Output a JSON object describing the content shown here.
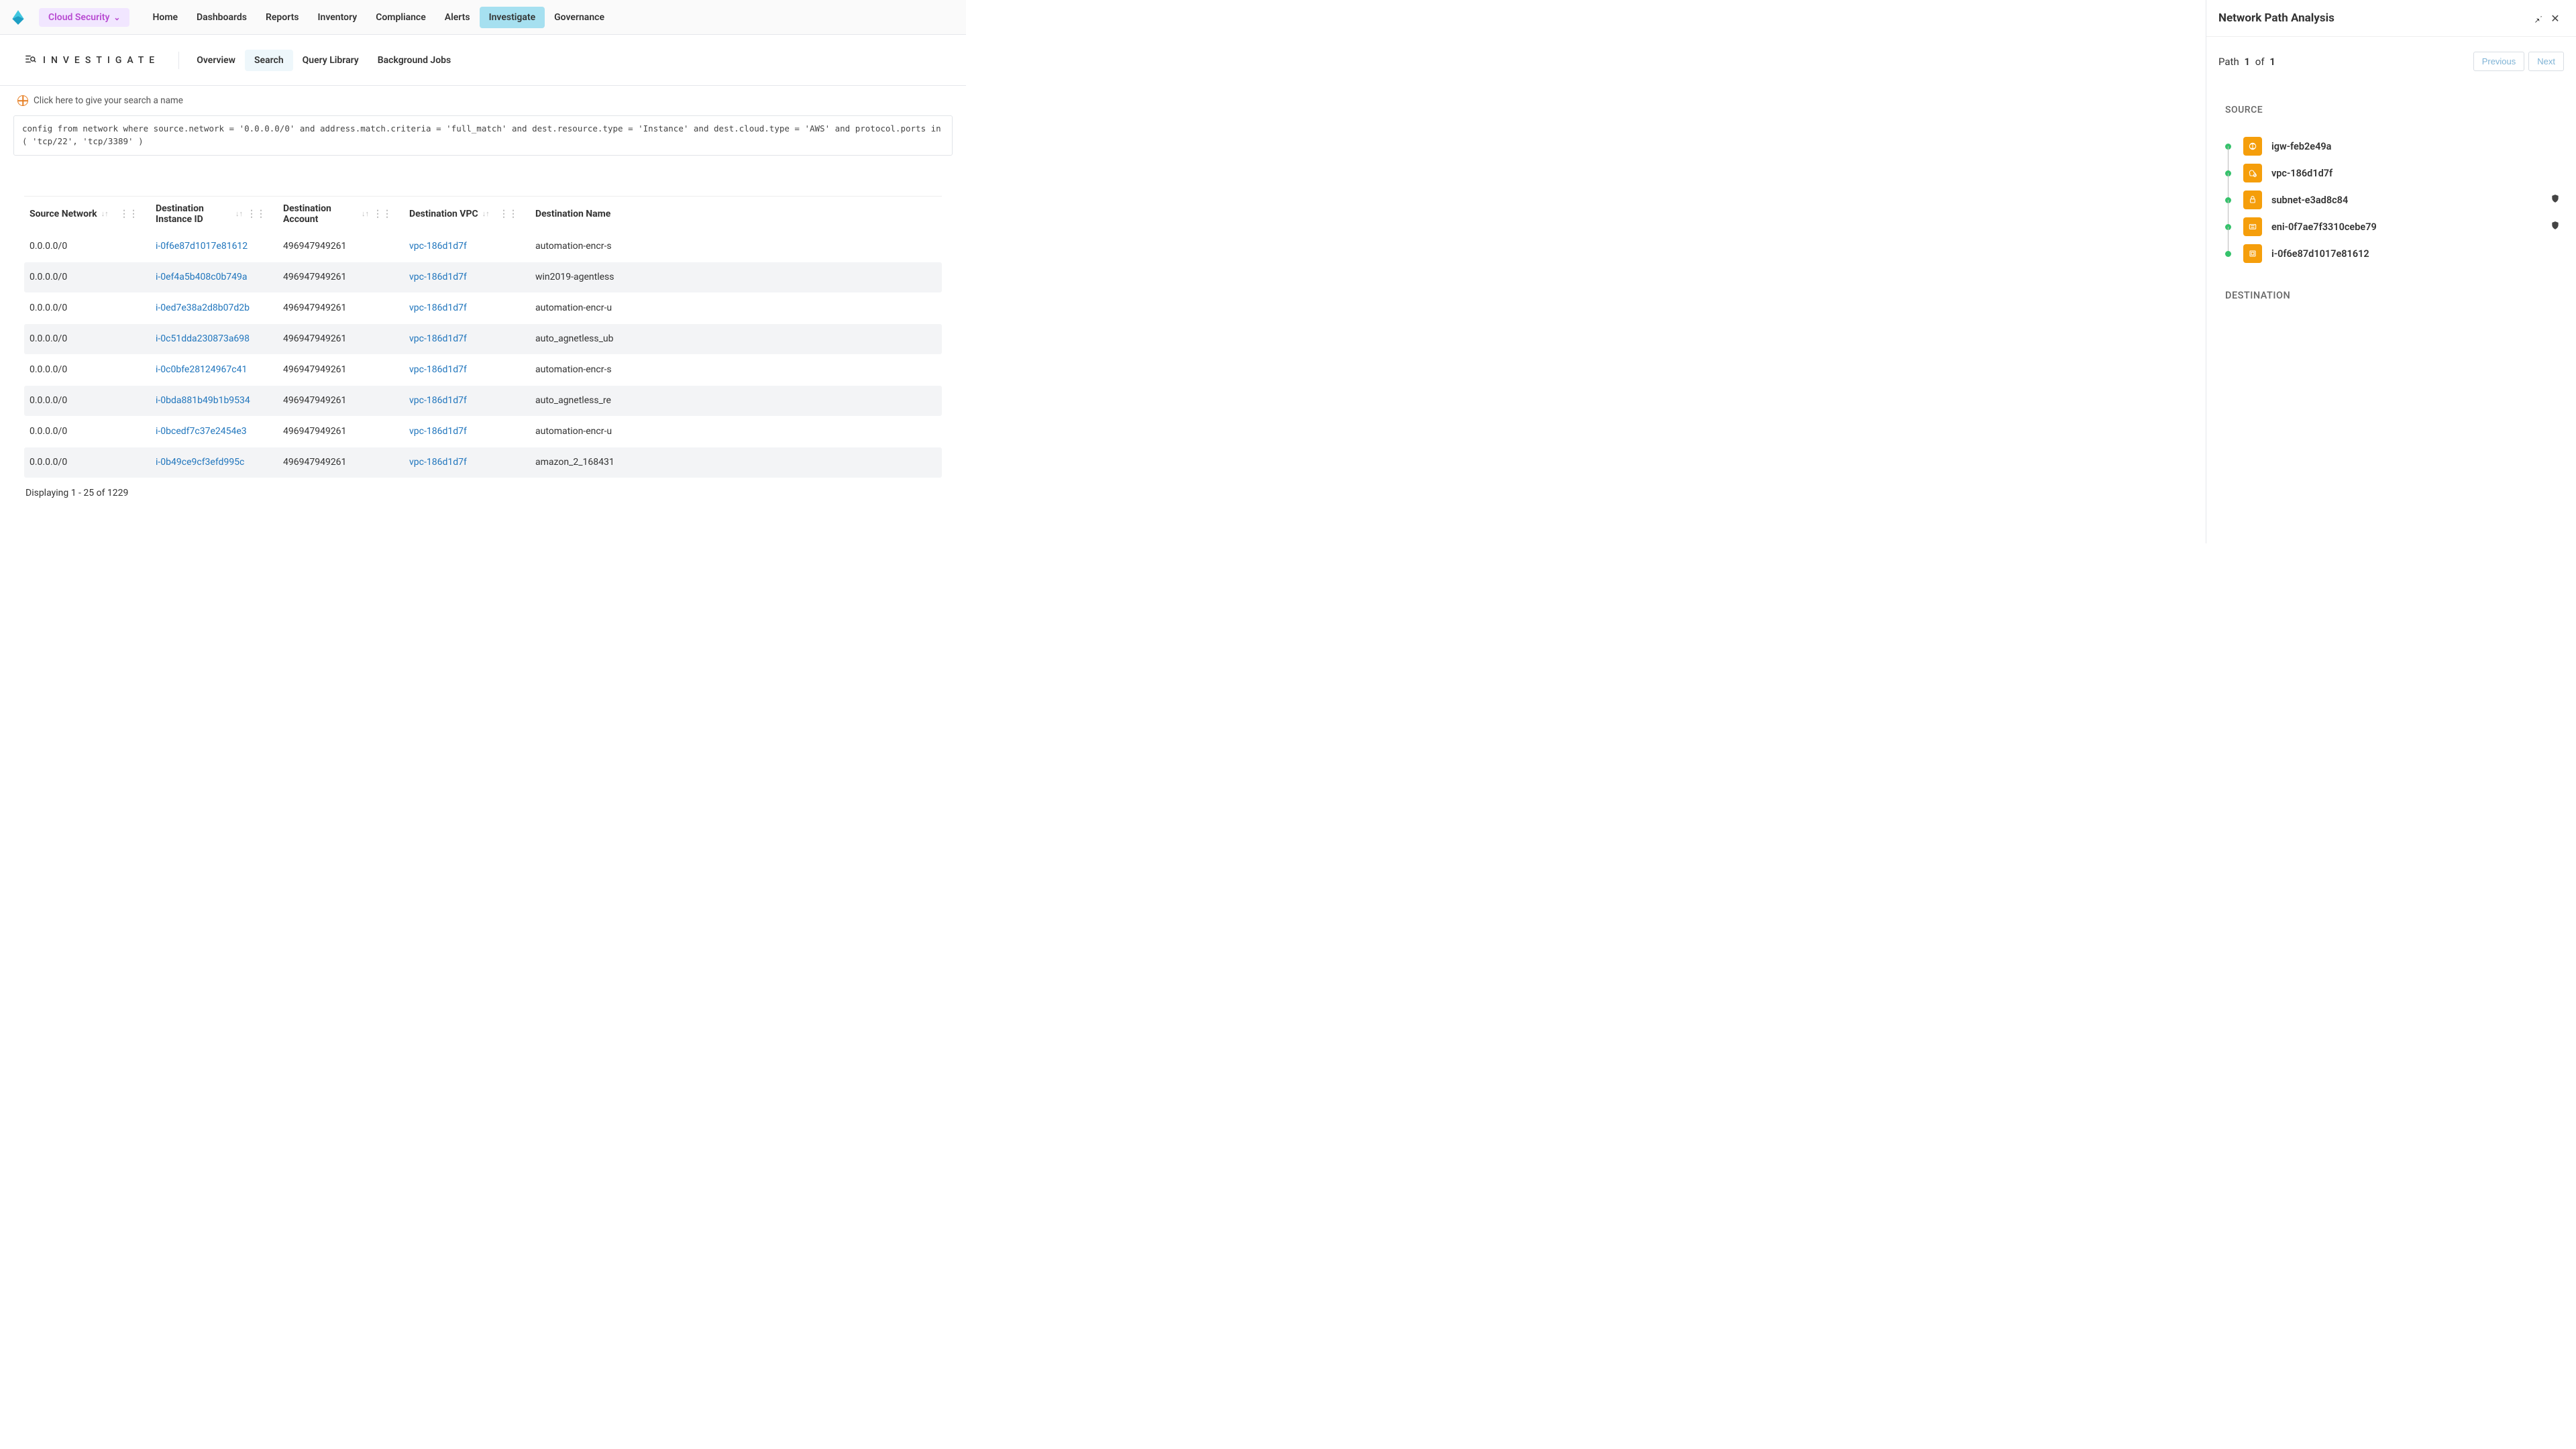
{
  "header": {
    "product": "Cloud Security",
    "nav": [
      "Home",
      "Dashboards",
      "Reports",
      "Inventory",
      "Compliance",
      "Alerts",
      "Investigate",
      "Governance"
    ],
    "active_nav": "Investigate"
  },
  "subheader": {
    "title": "INVESTIGATE",
    "tabs": [
      "Overview",
      "Search",
      "Query Library",
      "Background Jobs"
    ],
    "active_tab": "Search"
  },
  "search": {
    "name_prompt": "Click here to give your search a name",
    "query": "config from network where source.network = '0.0.0.0/0' and address.match.criteria = 'full_match' and dest.resource.type = 'Instance' and dest.cloud.type = 'AWS' and protocol.ports in ( 'tcp/22', 'tcp/3389' )"
  },
  "table": {
    "columns": [
      "Source Network",
      "Destination Instance ID",
      "Destination Account",
      "Destination VPC",
      "Destination Name"
    ],
    "rows": [
      {
        "src": "0.0.0.0/0",
        "inst": "i-0f6e87d1017e81612",
        "acct": "496947949261",
        "vpc": "vpc-186d1d7f",
        "name": "automation-encr-s"
      },
      {
        "src": "0.0.0.0/0",
        "inst": "i-0ef4a5b408c0b749a",
        "acct": "496947949261",
        "vpc": "vpc-186d1d7f",
        "name": "win2019-agentless"
      },
      {
        "src": "0.0.0.0/0",
        "inst": "i-0ed7e38a2d8b07d2b",
        "acct": "496947949261",
        "vpc": "vpc-186d1d7f",
        "name": "automation-encr-u"
      },
      {
        "src": "0.0.0.0/0",
        "inst": "i-0c51dda230873a698",
        "acct": "496947949261",
        "vpc": "vpc-186d1d7f",
        "name": "auto_agnetless_ub"
      },
      {
        "src": "0.0.0.0/0",
        "inst": "i-0c0bfe28124967c41",
        "acct": "496947949261",
        "vpc": "vpc-186d1d7f",
        "name": "automation-encr-s"
      },
      {
        "src": "0.0.0.0/0",
        "inst": "i-0bda881b49b1b9534",
        "acct": "496947949261",
        "vpc": "vpc-186d1d7f",
        "name": "auto_agnetless_re"
      },
      {
        "src": "0.0.0.0/0",
        "inst": "i-0bcedf7c37e2454e3",
        "acct": "496947949261",
        "vpc": "vpc-186d1d7f",
        "name": "automation-encr-u"
      },
      {
        "src": "0.0.0.0/0",
        "inst": "i-0b49ce9cf3efd995c",
        "acct": "496947949261",
        "vpc": "vpc-186d1d7f",
        "name": "amazon_2_168431"
      }
    ],
    "pager": "Displaying 1 - 25 of 1229"
  },
  "panel": {
    "title": "Network Path Analysis",
    "path_label_prefix": "Path",
    "path_num": "1",
    "path_of": "of",
    "path_total": "1",
    "prev": "Previous",
    "next": "Next",
    "source_label": "SOURCE",
    "dest_label": "DESTINATION",
    "path": [
      {
        "icon": "gateway",
        "name": "igw-feb2e49a",
        "shield": false
      },
      {
        "icon": "vpc",
        "name": "vpc-186d1d7f",
        "shield": false
      },
      {
        "icon": "subnet",
        "name": "subnet-e3ad8c84",
        "shield": true
      },
      {
        "icon": "eni",
        "name": "eni-0f7ae7f3310cebe79",
        "shield": true
      },
      {
        "icon": "instance",
        "name": "i-0f6e87d1017e81612",
        "shield": false
      }
    ]
  }
}
